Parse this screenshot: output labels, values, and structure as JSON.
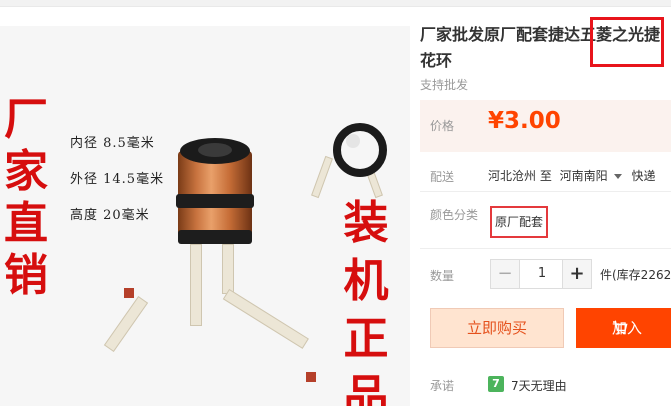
{
  "image": {
    "left_text": "厂家直销",
    "right_text": "装机正品",
    "specs": [
      "内径 8.5毫米",
      "外径 14.5毫米",
      "高度 20毫米"
    ]
  },
  "product": {
    "title_line1": "厂家批发原厂配套捷达五菱之光捷",
    "title_line2": "花环",
    "subtitle": "支持批发"
  },
  "price": {
    "label": "价格",
    "value": "¥3.00"
  },
  "delivery": {
    "label": "配送",
    "from": "河北沧州 至",
    "to": "河南南阳",
    "method": "快递"
  },
  "color": {
    "label": "颜色分类",
    "selected": "原厂配套"
  },
  "quantity": {
    "label": "数量",
    "minus": "−",
    "value": "1",
    "plus": "+",
    "stock_text": "件(库存2262"
  },
  "actions": {
    "buy_now": "立即购买",
    "add_to_cart": "加入"
  },
  "promise": {
    "label": "承诺",
    "badge": "7",
    "text": "7天无理由"
  },
  "colors": {
    "accent": "#ff4400",
    "highlight": "#e8141b",
    "image_text": "#d60e0e"
  }
}
